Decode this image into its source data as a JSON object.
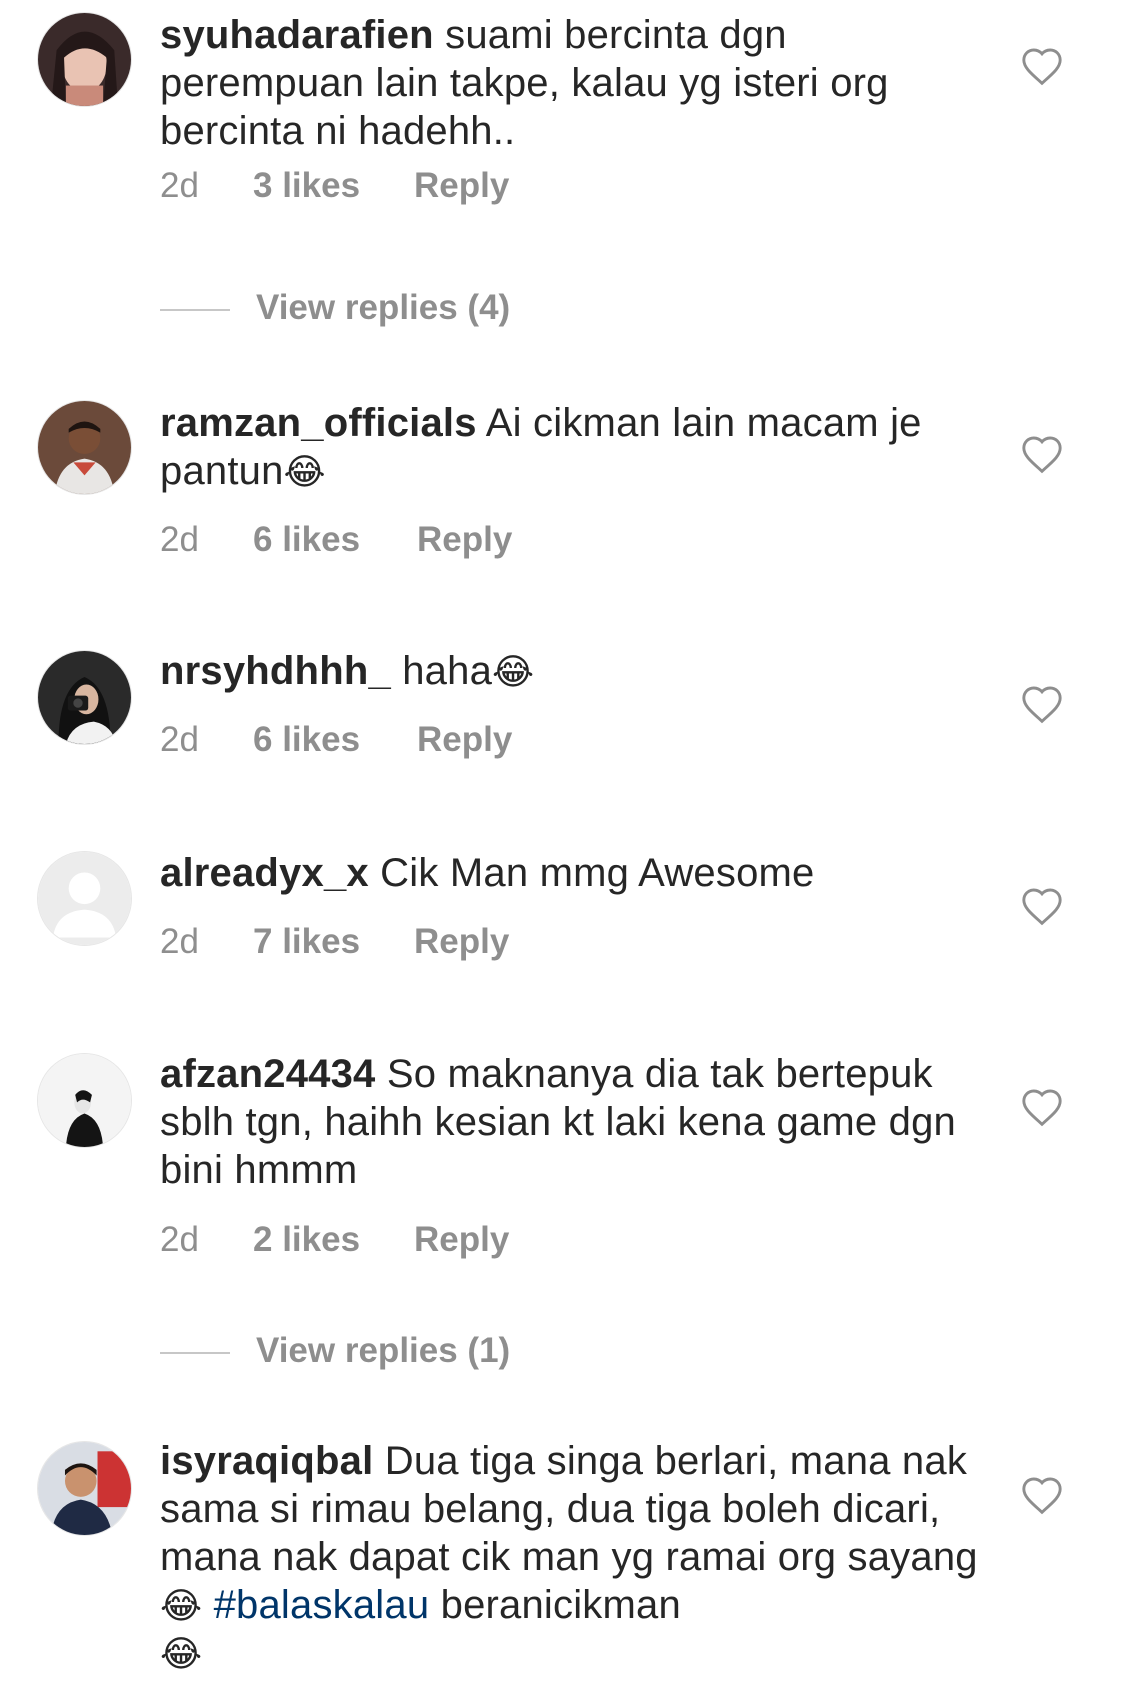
{
  "comments": [
    {
      "username": "syuhadarafien",
      "text": "suami bercinta dgn perempuan lain takpe, kalau yg isteri org bercinta ni hadehh..",
      "time": "2d",
      "likes": "3 likes",
      "reply": "Reply",
      "view_replies": "View replies (4)"
    },
    {
      "username": "ramzan_officials",
      "text": "Ai cikman lain macam je pantun",
      "emoji": "😂",
      "time": "2d",
      "likes": "6 likes",
      "reply": "Reply"
    },
    {
      "username": "nrsyhdhhh_",
      "text": "haha",
      "emoji": "😂",
      "time": "2d",
      "likes": "6 likes",
      "reply": "Reply"
    },
    {
      "username": "alreadyx_x",
      "text": "Cik Man mmg Awesome",
      "time": "2d",
      "likes": "7 likes",
      "reply": "Reply"
    },
    {
      "username": "afzan24434",
      "text": "So maknanya dia tak bertepuk sblh tgn, haihh kesian kt laki kena game dgn bini hmmm",
      "time": "2d",
      "likes": "2 likes",
      "reply": "Reply",
      "view_replies": "View replies (1)"
    },
    {
      "username": "isyraqiqbal",
      "text_before": "Dua tiga singa berlari, mana nak sama si rimau belang, dua tiga boleh dicari, mana nak dapat cik man yg ramai org sayang",
      "emoji": "😂",
      "hashtag": "#balaskalau",
      "text_after": "beranicikman",
      "emoji_end": "😂"
    }
  ],
  "icons": {
    "heart": "heart-outline-icon",
    "avatar_placeholder": "default-avatar-icon"
  },
  "colors": {
    "text": "#262626",
    "meta": "#8e8e8e",
    "hashtag": "#003569",
    "divider": "#c7c7c7"
  }
}
